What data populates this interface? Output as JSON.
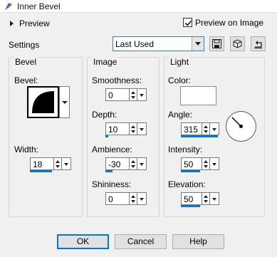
{
  "window": {
    "title": "Inner Bevel"
  },
  "preview": {
    "label": "Preview"
  },
  "preview_on_image": {
    "label": "Preview on Image",
    "checked": true
  },
  "settings": {
    "label": "Settings",
    "selected": "Last Used"
  },
  "bevel_group": {
    "title": "Bevel",
    "bevel_label": "Bevel:",
    "width_label": "Width:",
    "width_value": "18"
  },
  "image_group": {
    "title": "Image",
    "smoothness_label": "Smoothness:",
    "smoothness_value": "0",
    "depth_label": "Depth:",
    "depth_value": "10",
    "ambience_label": "Ambience:",
    "ambience_value": "-30",
    "shininess_label": "Shininess:",
    "shininess_value": "0"
  },
  "light_group": {
    "title": "Light",
    "color_label": "Color:",
    "color_value": "#ffffff",
    "angle_label": "Angle:",
    "angle_value": "315",
    "intensity_label": "Intensity:",
    "intensity_value": "50",
    "elevation_label": "Elevation:",
    "elevation_value": "50"
  },
  "buttons": {
    "ok": "OK",
    "cancel": "Cancel",
    "help": "Help"
  },
  "colors": {
    "accent": "#0078d7",
    "dialog_bg": "#f0f0f0"
  },
  "icons": [
    "app-icon",
    "save-preset-icon",
    "cube-icon",
    "reset-icon"
  ]
}
